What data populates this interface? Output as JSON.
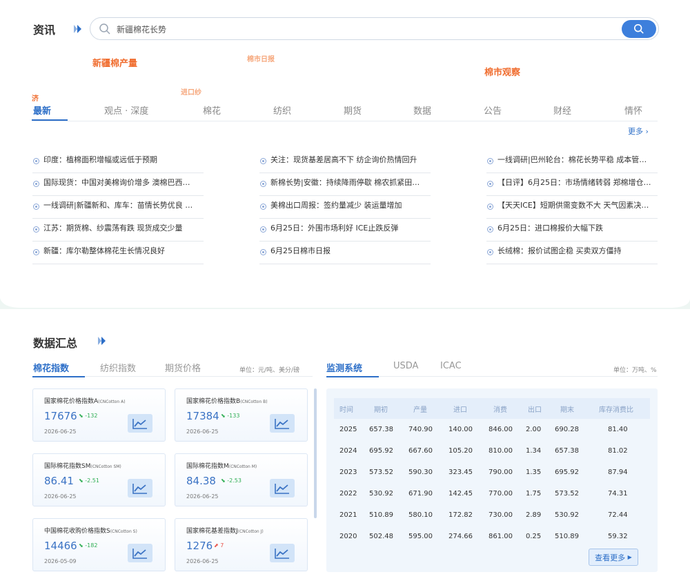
{
  "news": {
    "title": "资讯",
    "search": {
      "value": "新疆棉花长势"
    },
    "hot_tags": [
      "新疆棉产量",
      "棉市日报",
      "棉市观察",
      "进口纱",
      "济"
    ],
    "tabs": [
      "最新",
      "观点 · 深度",
      "棉花",
      "纺织",
      "期货",
      "数据",
      "公告",
      "财经",
      "情怀"
    ],
    "more": "更多",
    "columns": [
      [
        "印度：植棉面积增幅或远低于预期",
        "国际现货：中国对美棉询价增多 澳棉巴西…",
        "一线调研|新疆新和、库车：苗情长势优良 …",
        "江苏：期货棉、纱震荡有跌 现货成交少量",
        "新疆：库尔勒整体棉花生长情况良好"
      ],
      [
        "关注：现货基差居高不下 纺企询价热情回升",
        "新棉长势|安徽：持续降雨停歇 棉农抓紧田…",
        "美棉出口周报：签约量减少 装运量增加",
        "6月25日：外围市场利好 ICE止跌反弹",
        "6月25日棉市日报"
      ],
      [
        "一线调研|巴州轮台：棉花长势平稳 成本管…",
        "【日评】6月25日：市场情绪转弱 郑棉增仓…",
        "【天天ICE】短期供需变数不大 天气因素决…",
        "6月25日：进口棉报价大幅下跌",
        "长绒棉：报价试图企稳 买卖双方僵持"
      ]
    ]
  },
  "data": {
    "title": "数据汇总",
    "left_tabs": [
      "棉花指数",
      "纺织指数",
      "期货价格"
    ],
    "left_unit": "单位：元/吨、美分/磅",
    "right_tabs": [
      "监测系统",
      "USDA",
      "ICAC"
    ],
    "right_unit": "单位：万吨、%",
    "cards": [
      {
        "name": "国家棉花价格指数A",
        "code": "(CNCotton A)",
        "value": "17676",
        "change": "-132",
        "dir": "down",
        "date": "2026-06-25"
      },
      {
        "name": "国家棉花价格指数B",
        "code": "(CNCotton B)",
        "value": "17384",
        "change": "-133",
        "dir": "down",
        "date": "2026-06-25"
      },
      {
        "name": "国际棉花指数SM",
        "code": "(CNCotton SM)",
        "value": "86.41",
        "change": "-2.51",
        "dir": "down",
        "date": "2026-06-25"
      },
      {
        "name": "国际棉花指数M",
        "code": "(CNCotton M)",
        "value": "84.38",
        "change": "-2.53",
        "dir": "down",
        "date": "2026-06-25"
      },
      {
        "name": "中国棉花收购价格指数S",
        "code": "(CNCotton S)",
        "value": "14466",
        "change": "-182",
        "dir": "down",
        "date": "2026-05-09"
      },
      {
        "name": "国家棉花基差指数J",
        "code": "(CNCotton J)",
        "value": "1276",
        "change": "7",
        "dir": "up",
        "date": "2026-06-25"
      }
    ],
    "table": {
      "headers": [
        "时间",
        "期初",
        "产量",
        "进口",
        "消费",
        "出口",
        "期末",
        "库存消费比"
      ],
      "rows": [
        [
          "2025",
          "657.38",
          "740.90",
          "140.00",
          "846.00",
          "2.00",
          "690.28",
          "81.40"
        ],
        [
          "2024",
          "695.92",
          "667.60",
          "105.20",
          "810.00",
          "1.34",
          "657.38",
          "81.02"
        ],
        [
          "2023",
          "573.52",
          "590.30",
          "323.45",
          "790.00",
          "1.35",
          "695.92",
          "87.94"
        ],
        [
          "2022",
          "530.92",
          "671.90",
          "142.45",
          "770.00",
          "1.75",
          "573.52",
          "74.31"
        ],
        [
          "2021",
          "510.89",
          "580.10",
          "172.82",
          "730.00",
          "2.89",
          "530.92",
          "72.44"
        ],
        [
          "2020",
          "502.48",
          "595.00",
          "274.66",
          "861.00",
          "0.25",
          "510.89",
          "59.32"
        ]
      ],
      "more": "查看更多"
    }
  },
  "colors": {
    "accent": "#2d6fc8",
    "hot": "#f06d2f",
    "down": "#2fae53",
    "up": "#e8534a"
  }
}
